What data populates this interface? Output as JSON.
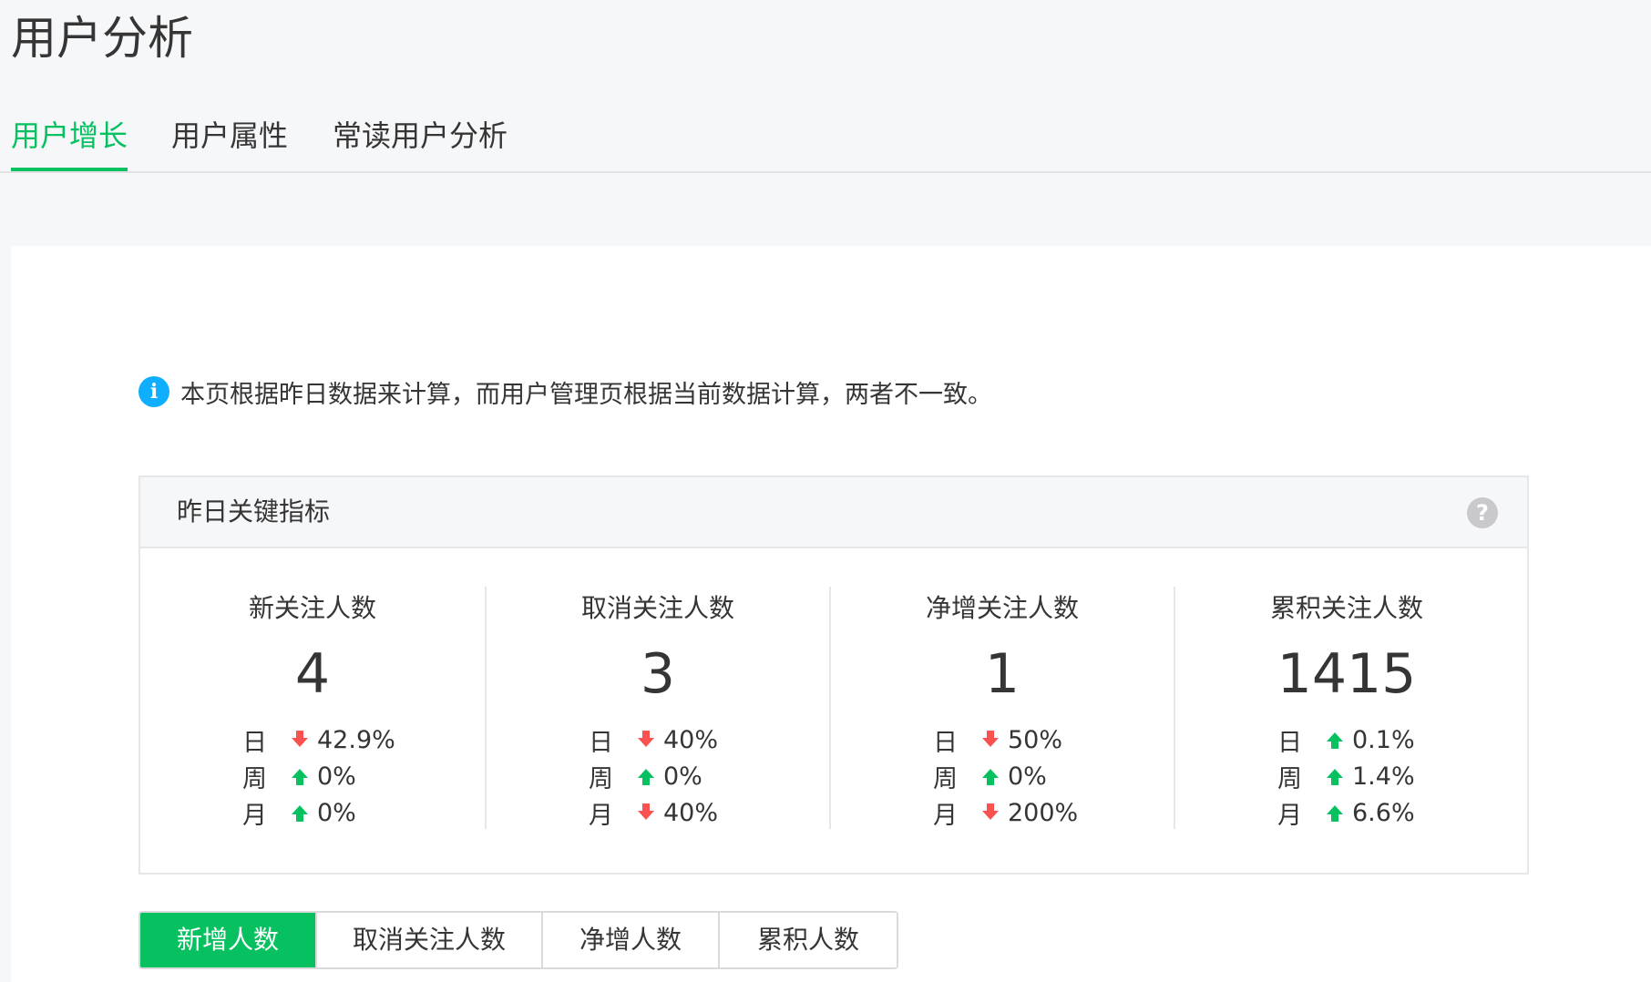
{
  "page": {
    "title": "用户分析"
  },
  "tabs": [
    {
      "label": "用户增长",
      "active": true
    },
    {
      "label": "用户属性",
      "active": false
    },
    {
      "label": "常读用户分析",
      "active": false
    }
  ],
  "notice": {
    "icon": "info-icon",
    "text": "本页根据昨日数据来计算，而用户管理页根据当前数据计算，两者不一致。"
  },
  "metrics": {
    "title": "昨日关键指标",
    "help_icon": "?",
    "items": [
      {
        "label": "新关注人数",
        "value": "4",
        "rows": [
          {
            "label": "日",
            "direction": "down",
            "value": "42.9%"
          },
          {
            "label": "周",
            "direction": "up",
            "value": "0%"
          },
          {
            "label": "月",
            "direction": "up",
            "value": "0%"
          }
        ]
      },
      {
        "label": "取消关注人数",
        "value": "3",
        "rows": [
          {
            "label": "日",
            "direction": "down",
            "value": "40%"
          },
          {
            "label": "周",
            "direction": "up",
            "value": "0%"
          },
          {
            "label": "月",
            "direction": "down",
            "value": "40%"
          }
        ]
      },
      {
        "label": "净增关注人数",
        "value": "1",
        "rows": [
          {
            "label": "日",
            "direction": "down",
            "value": "50%"
          },
          {
            "label": "周",
            "direction": "up",
            "value": "0%"
          },
          {
            "label": "月",
            "direction": "down",
            "value": "200%"
          }
        ]
      },
      {
        "label": "累积关注人数",
        "value": "1415",
        "rows": [
          {
            "label": "日",
            "direction": "up",
            "value": "0.1%"
          },
          {
            "label": "周",
            "direction": "up",
            "value": "1.4%"
          },
          {
            "label": "月",
            "direction": "up",
            "value": "6.6%"
          }
        ]
      }
    ]
  },
  "chart_tabs": [
    {
      "label": "新增人数",
      "active": true
    },
    {
      "label": "取消关注人数",
      "active": false
    },
    {
      "label": "净增人数",
      "active": false
    },
    {
      "label": "累积人数",
      "active": false
    }
  ],
  "colors": {
    "accent": "#07c160",
    "down": "#fa5151",
    "up": "#07c160",
    "info": "#10aeff"
  }
}
